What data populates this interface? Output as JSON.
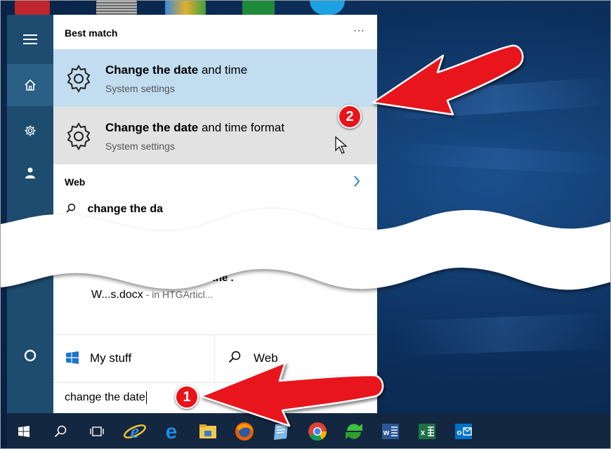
{
  "colors": {
    "rail": "#1e4c6f",
    "highlight": "#c2dcf0",
    "hover": "#e2e2e2",
    "taskbar": "#132740",
    "accent": "#1e74c9",
    "arrow": "#e8141a"
  },
  "rail": {
    "items": [
      {
        "icon": "hamburger-icon"
      },
      {
        "icon": "home-icon"
      },
      {
        "icon": "gear-icon"
      },
      {
        "icon": "feedback-icon"
      },
      {
        "icon": "cortana-icon"
      }
    ]
  },
  "panel": {
    "best_match_header": "Best match",
    "more_label": "···",
    "results": [
      {
        "title_bold": "Change the date",
        "title_rest": " and time",
        "subtitle": "System settings",
        "icon": "gear-icon"
      },
      {
        "title_bold": "Change the date",
        "title_rest": " and time format",
        "subtitle": "System settings",
        "icon": "gear-icon"
      }
    ],
    "web_header": "Web",
    "web_suggestion": "change the da",
    "partial_doc_line": "ɔe the .",
    "partial_doc_name": "W...s.docx",
    "partial_doc_location": " - in HTGArticl...",
    "filters": {
      "mystuff_label": "My stuff",
      "web_label": "Web"
    }
  },
  "search": {
    "value": "change the date"
  },
  "callouts": {
    "one": "1",
    "two": "2"
  },
  "taskbar": {
    "items": [
      {
        "icon": "start-icon"
      },
      {
        "icon": "search-icon"
      },
      {
        "icon": "task-view-icon"
      },
      {
        "icon": "internet-explorer-icon"
      },
      {
        "icon": "edge-icon"
      },
      {
        "icon": "file-explorer-icon"
      },
      {
        "icon": "firefox-icon"
      },
      {
        "icon": "notepad-icon"
      },
      {
        "icon": "chrome-icon"
      },
      {
        "icon": "sync-icon"
      },
      {
        "icon": "word-icon"
      },
      {
        "icon": "excel-icon"
      },
      {
        "icon": "outlook-icon"
      }
    ]
  }
}
